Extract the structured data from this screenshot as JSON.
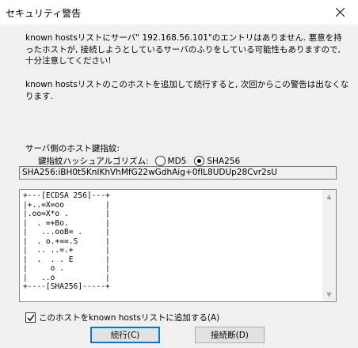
{
  "window": {
    "title": "セキュリティ警告"
  },
  "message": {
    "line_block_1": "known hostsリストにサーバ\" 192.168.56.101\"のエントリはありません. 悪意を持ったホストが, 接続しようとしているサーバのふりをしている可能性もありますので, 十分注意してください!",
    "line_block_2": "known hostsリストのこのホストを追加して続行すると, 次回からこの警告は出なくなります."
  },
  "fingerprint": {
    "label": "サーバ側のホスト鍵指紋:",
    "algo_label": "鍵指紋ハッシュアルゴリズム:",
    "options": [
      {
        "label": "MD5",
        "selected": false
      },
      {
        "label": "SHA256",
        "selected": true
      }
    ],
    "value": "SHA256:iBH0t5KnIKhVhMfG22wGdhAig+0fIL8UDUp28Cvr2sU"
  },
  "randomart": {
    "lines": "+---[ECDSA 256]---+\n|+..=X=oo         |\n|.oo=X*o .        |\n|  . =+Bo.        |\n|   ...ooB= .     |\n|  . o.+==.S      |\n|  .. ..=.+       |\n|  .  . . E       |\n|     o .         |\n|   ..o           |\n+----[SHA256]-----+"
  },
  "add_to_known_hosts": {
    "label": "このホストをknown hostsリストに追加する(A)",
    "checked": true
  },
  "buttons": {
    "continue": "続行(C)",
    "disconnect": "接続断(D)"
  }
}
